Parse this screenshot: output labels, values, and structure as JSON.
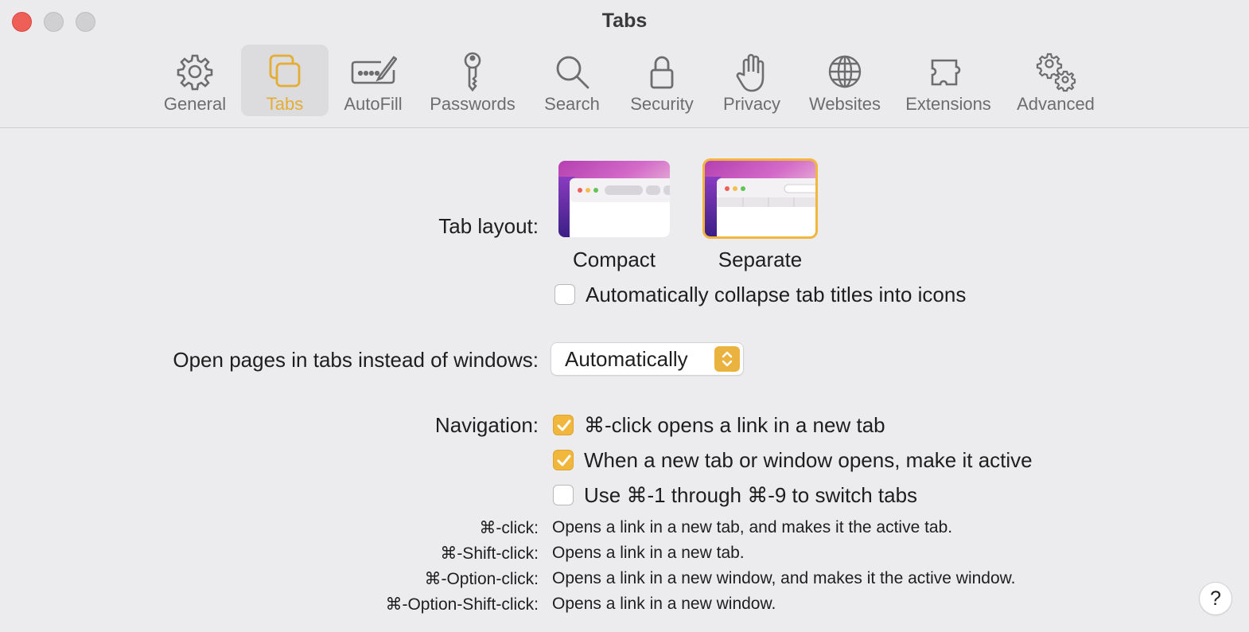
{
  "window": {
    "title": "Tabs"
  },
  "toolbar": {
    "items": [
      {
        "label": "General",
        "icon": "gear-icon"
      },
      {
        "label": "Tabs",
        "icon": "tabs-icon",
        "active": true
      },
      {
        "label": "AutoFill",
        "icon": "autofill-icon"
      },
      {
        "label": "Passwords",
        "icon": "key-icon"
      },
      {
        "label": "Search",
        "icon": "magnifier-icon"
      },
      {
        "label": "Security",
        "icon": "lock-icon"
      },
      {
        "label": "Privacy",
        "icon": "hand-icon"
      },
      {
        "label": "Websites",
        "icon": "globe-icon"
      },
      {
        "label": "Extensions",
        "icon": "puzzle-icon"
      },
      {
        "label": "Advanced",
        "icon": "gears-icon"
      }
    ]
  },
  "tab_layout": {
    "label": "Tab layout:",
    "options": [
      {
        "label": "Compact",
        "selected": false
      },
      {
        "label": "Separate",
        "selected": true
      }
    ],
    "collapse_checkbox": {
      "label": "Automatically collapse tab titles into icons",
      "checked": false
    }
  },
  "open_pages": {
    "label": "Open pages in tabs instead of windows:",
    "value": "Automatically"
  },
  "navigation": {
    "label": "Navigation:",
    "checkboxes": [
      {
        "label": "⌘-click opens a link in a new tab",
        "checked": true
      },
      {
        "label": "When a new tab or window opens, make it active",
        "checked": true
      },
      {
        "label": "Use ⌘-1 through ⌘-9 to switch tabs",
        "checked": false
      }
    ]
  },
  "shortcuts": [
    {
      "key": "⌘-click:",
      "desc": "Opens a link in a new tab, and makes it the active tab."
    },
    {
      "key": "⌘-Shift-click:",
      "desc": "Opens a link in a new tab."
    },
    {
      "key": "⌘-Option-click:",
      "desc": "Opens a link in a new window, and makes it the active window."
    },
    {
      "key": "⌘-Option-Shift-click:",
      "desc": "Opens a link in a new window."
    }
  ],
  "help": {
    "label": "?"
  },
  "colors": {
    "accent": "#f1b63c",
    "close": "#ee5f57"
  }
}
